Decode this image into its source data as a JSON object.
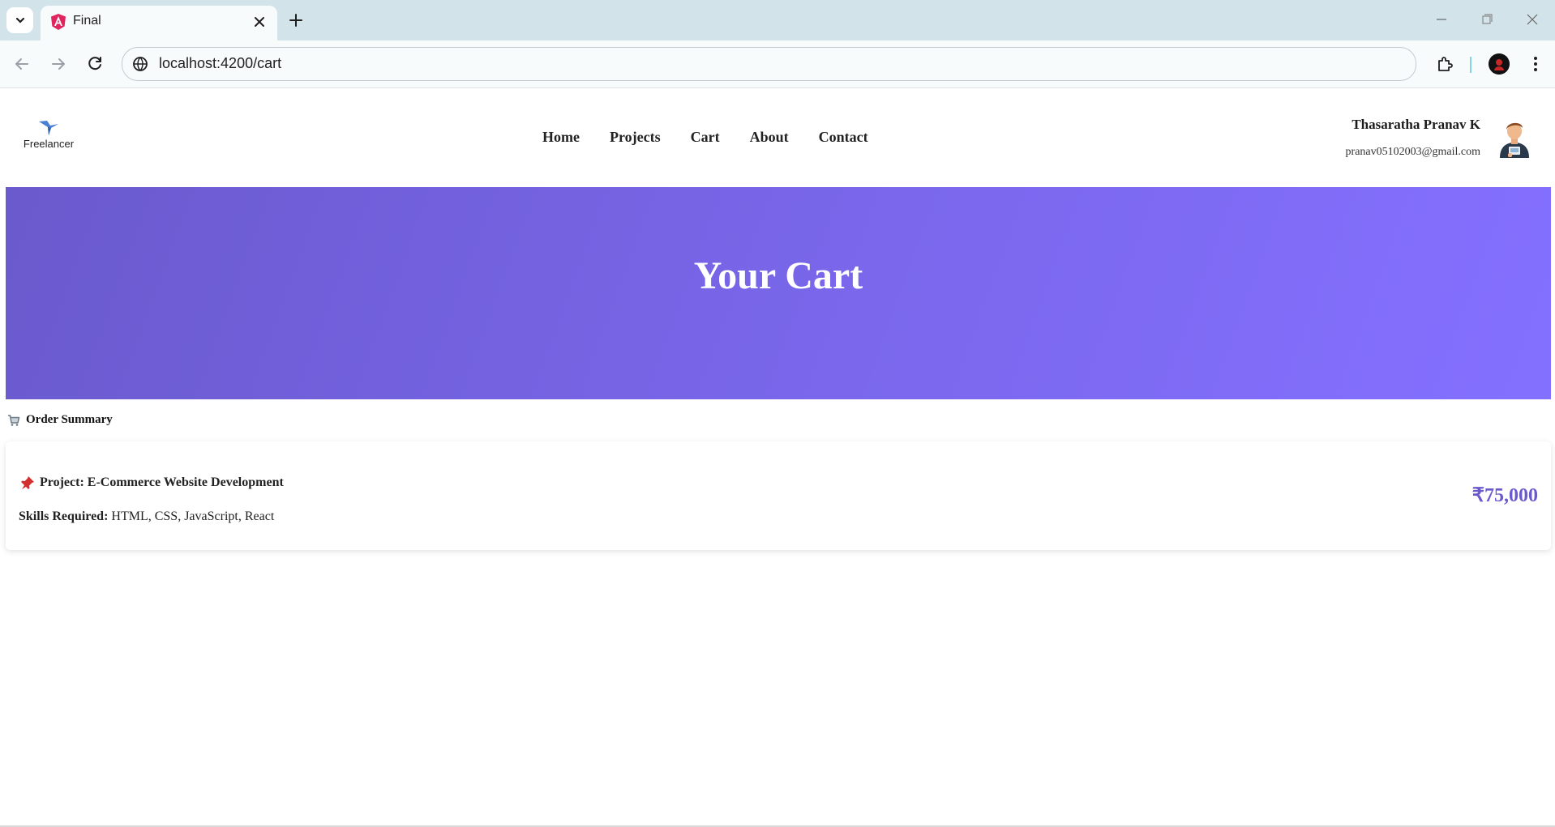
{
  "browser": {
    "tab_title": "Final",
    "url": "localhost:4200/cart"
  },
  "site": {
    "logo_text": "Freelancer",
    "nav": [
      "Home",
      "Projects",
      "Cart",
      "About",
      "Contact"
    ],
    "user": {
      "name": "Thasaratha Pranav K",
      "email": "pranav05102003@gmail.com"
    }
  },
  "hero": {
    "title": "Your Cart"
  },
  "summary": {
    "title": "Order Summary",
    "item": {
      "project": "Project: E-Commerce Website Development",
      "skills_label": "Skills Required:",
      "skills": "HTML, CSS, JavaScript, React",
      "price": "₹75,000"
    }
  },
  "colors": {
    "accent": "#6a5acd",
    "hero_gradient_start": "#6a5acd",
    "hero_gradient_end": "#8470ff"
  }
}
